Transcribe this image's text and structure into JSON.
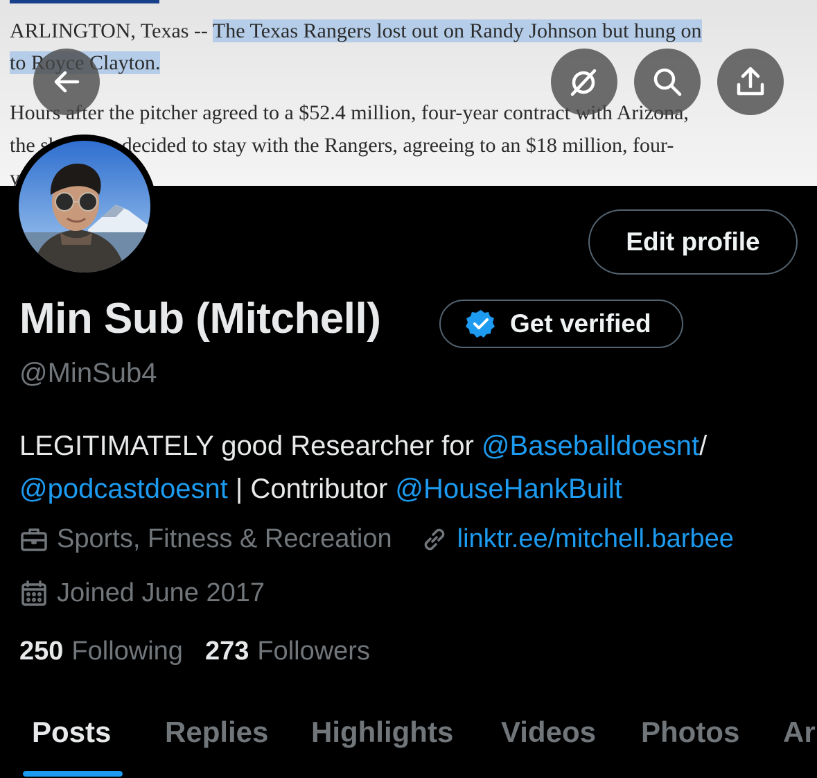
{
  "banner": {
    "line1_prefix": "ARLINGTON, Texas -- ",
    "line1_highlight": "The Texas Rangers lost out on Randy Johnson but hung on",
    "line2_highlight": "to Royce Clayton.",
    "line3": "Hours after the pitcher agreed to a $52.4 million, four-year contract with Arizona,",
    "line4": "the shortstop decided to stay with the Rangers, agreeing to an $18 million, four-",
    "line5": "year"
  },
  "nav": {
    "back_icon": "arrow-left-icon",
    "grok_icon": "grok-icon",
    "search_icon": "search-icon",
    "share_icon": "share-icon"
  },
  "profile": {
    "edit_label": "Edit profile",
    "name": "Min Sub (Mitchell)",
    "verify_label": "Get verified",
    "handle": "@MinSub4",
    "bio": {
      "part1": "LEGITIMATELY good Researcher for ",
      "mention1": "@Baseballdoesnt",
      "part2": "/",
      "mention2": "@podcastdoesnt",
      "part3": " | Contributor ",
      "mention3": "@HouseHankBuilt"
    },
    "category": "Sports, Fitness & Recreation",
    "link": "linktr.ee/mitchell.barbee",
    "joined": "Joined June 2017",
    "following_count": "250",
    "following_label": "Following",
    "followers_count": "273",
    "followers_label": "Followers"
  },
  "tabs": [
    "Posts",
    "Replies",
    "Highlights",
    "Videos",
    "Photos",
    "Ar"
  ],
  "colors": {
    "accent": "#1d9bf0",
    "background": "#000000",
    "secondary_text": "#71767b",
    "highlight": "#b5cde8"
  }
}
